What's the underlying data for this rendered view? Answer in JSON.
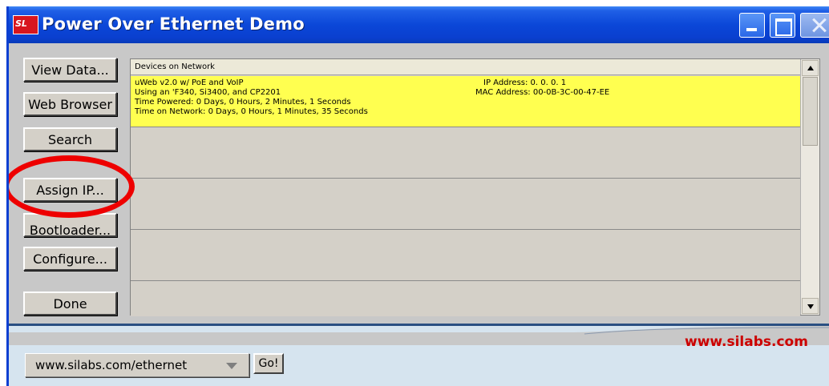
{
  "window": {
    "title": "Power Over Ethernet Demo",
    "logo_text": "SL",
    "title_bar_color": "#0a3fcf"
  },
  "buttons": {
    "view_data": "View Data...",
    "web_browser": "Web Browser",
    "search": "Search",
    "assign_ip": "Assign IP...",
    "bootloader": "Bootloader...",
    "configure": "Configure...",
    "done": "Done"
  },
  "devices_panel": {
    "header": "Devices on Network",
    "selected_row_color": "#ffff50",
    "devices": [
      {
        "name_line": "uWeb v2.0 w/ PoE and VoIP",
        "parts_line": "Using an 'F340, Si3400, and CP2201",
        "time_powered": "Time Powered: 0 Days,  0 Hours,  2 Minutes,  1 Seconds",
        "time_network": "Time on Network: 0 Days,  0 Hours,  1 Minutes, 35 Seconds",
        "ip": "IP Address:   0.  0.  0.  1",
        "mac": "MAC Address:  00-0B-3C-00-47-EE"
      }
    ]
  },
  "annotation": {
    "highlight_color": "#ee0000",
    "highlight_target": "assign-ip-button"
  },
  "footer": {
    "site_link": "www.silabs.com",
    "url_value": "www.silabs.com/ethernet",
    "go_label": "Go!",
    "site_link_color": "#cc0000"
  }
}
